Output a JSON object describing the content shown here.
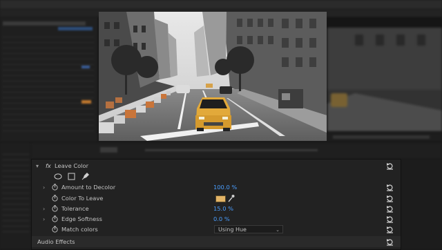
{
  "effect": {
    "name": "Leave Color",
    "fx_symbol": "fx",
    "mask_tools": [
      "ellipse-mask-icon",
      "rectangle-mask-icon",
      "pen-mask-icon"
    ],
    "properties": [
      {
        "label": "Amount to Decolor",
        "value": "100.0 %"
      },
      {
        "label": "Color To Leave",
        "color": "#e3b466"
      },
      {
        "label": "Tolerance",
        "value": "15.0 %"
      },
      {
        "label": "Edge Softness",
        "value": "0.0 %"
      },
      {
        "label": "Match colors",
        "dropdown": "Using Hue"
      }
    ]
  },
  "audio_effects_label": "Audio Effects",
  "accent_color": "#4a9eff"
}
